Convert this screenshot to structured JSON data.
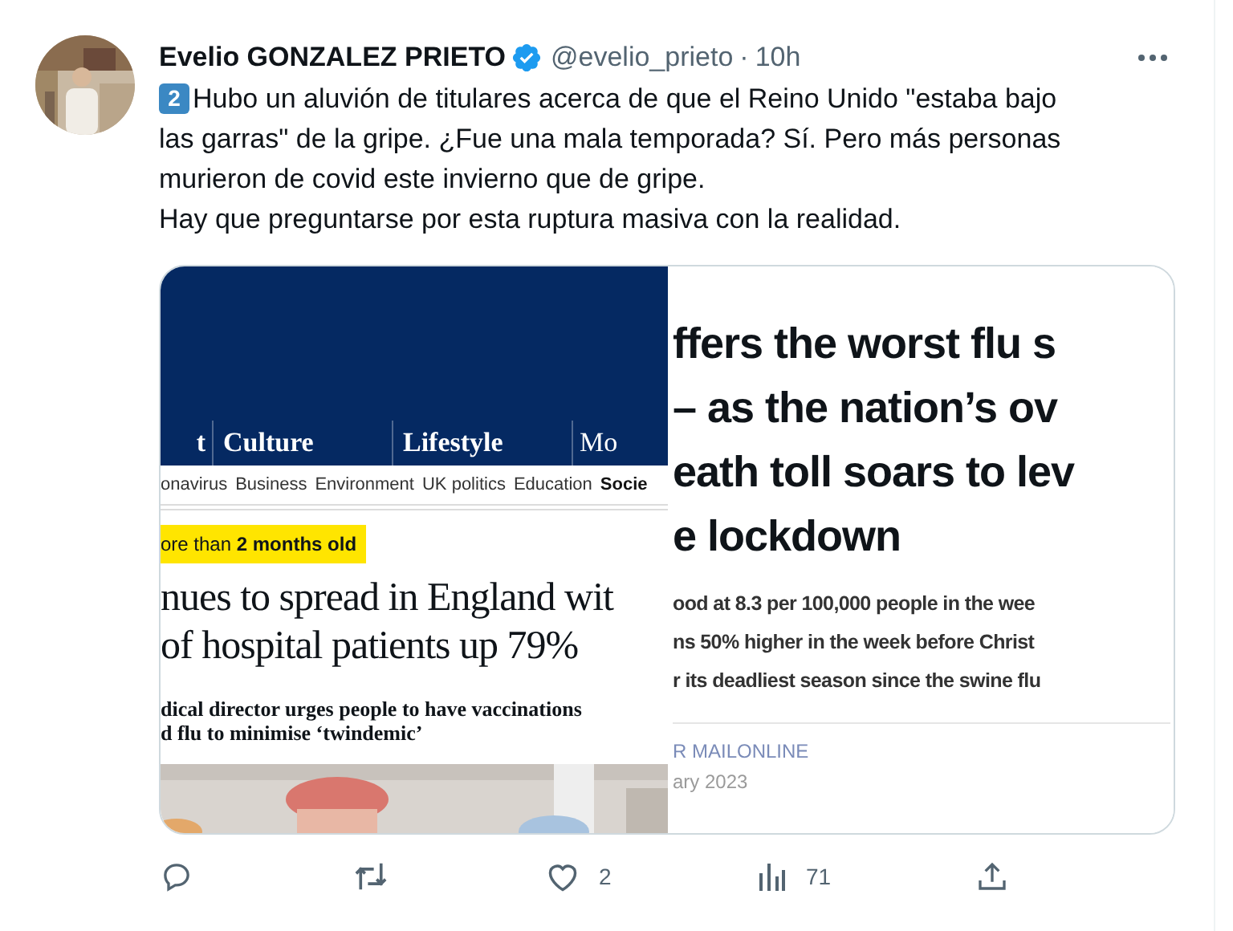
{
  "author": {
    "name": "Evelio GONZALEZ PRIETO",
    "verified": true,
    "handle": "@evelio_prieto",
    "separator": "·",
    "time": "10h"
  },
  "tweet": {
    "badge": "2",
    "lines": [
      "Hubo un aluvión de titulares acerca de que el Reino Unido \"estaba bajo",
      "las garras\" de la gripe. ¿Fue una mala temporada? Sí. Pero más personas",
      "murieron de covid este invierno que de gripe.",
      "Hay que preguntarse por esta ruptura masiva con la realidad."
    ]
  },
  "media": {
    "left": {
      "nav": [
        "t",
        "Culture",
        "Lifestyle",
        "Mo"
      ],
      "sections": [
        {
          "label": "onavirus",
          "selected": false
        },
        {
          "label": "Business",
          "selected": false
        },
        {
          "label": "Environment",
          "selected": false
        },
        {
          "label": "UK politics",
          "selected": false
        },
        {
          "label": "Education",
          "selected": false
        },
        {
          "label": "Socie",
          "selected": true
        }
      ],
      "notice": "ore than **2 months old**",
      "headline": [
        "nues to spread in England wit",
        "of hospital patients up 79%"
      ],
      "standfirst": [
        "dical director urges people to have vaccinations",
        "d flu to minimise ‘twindemic’"
      ]
    },
    "right": {
      "headline": [
        "ffers the worst flu s",
        "– as the nation’s ov",
        "eath toll soars to lev",
        "e lockdown"
      ],
      "bullets": [
        "ood at 8.3 per 100,000 people in the wee",
        "ns 50% higher in the week before Christ",
        "r its deadliest season since the swine flu"
      ],
      "byline": "R MAILONLINE",
      "date": "ary 2023"
    }
  },
  "actions": [
    {
      "kind": "reply"
    },
    {
      "kind": "retweet"
    },
    {
      "kind": "like",
      "count": "2"
    },
    {
      "kind": "views",
      "count": "71"
    },
    {
      "kind": "share"
    }
  ]
}
